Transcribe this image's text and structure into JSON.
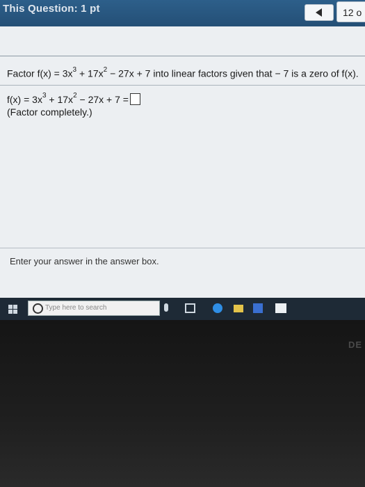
{
  "header": {
    "question_label": "This Question: 1 pt",
    "question_count": "12 o"
  },
  "question": {
    "prompt_part1": "Factor f(x) = 3x",
    "prompt_part2": " + 17x",
    "prompt_part3": " − 27x + 7 into linear factors given that  − 7 is a zero of f(x).",
    "exp3": "3",
    "exp2": "2",
    "answer_part1": "f(x) = 3x",
    "answer_part2": " + 17x",
    "answer_part3": " − 27x + 7 =",
    "hint": "(Factor completely.)"
  },
  "footer": {
    "instruction": "Enter your answer in the answer box."
  },
  "taskbar": {
    "search_placeholder": "Type here to search"
  },
  "device": {
    "brand": "DE"
  }
}
